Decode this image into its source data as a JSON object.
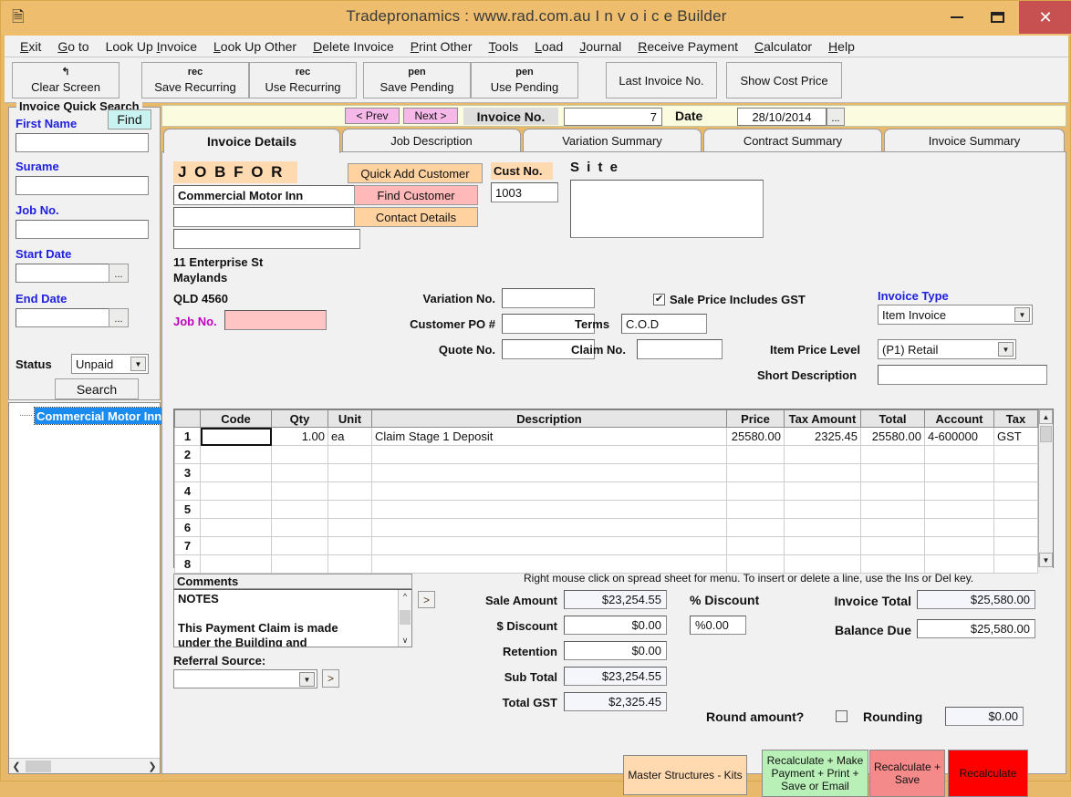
{
  "window": {
    "title": "Tradepronamics :   www.rad.com.au    I n v o i c e   Builder",
    "icon": "window-app-icon",
    "minimize": "–",
    "maximize": "□",
    "close": "✕"
  },
  "menu": [
    {
      "label": "Exit",
      "accel": "E"
    },
    {
      "label": "Go to",
      "accel": "G"
    },
    {
      "label": "Look Up Invoice",
      "accel": "I"
    },
    {
      "label": "Look Up Other",
      "accel": "L"
    },
    {
      "label": "Delete Invoice",
      "accel": "D"
    },
    {
      "label": "Print Other",
      "accel": "P"
    },
    {
      "label": "Tools",
      "accel": "T"
    },
    {
      "label": "Load",
      "accel": "L"
    },
    {
      "label": "Journal",
      "accel": "J"
    },
    {
      "label": "Receive Payment",
      "accel": "R"
    },
    {
      "label": "Calculator",
      "accel": "C"
    },
    {
      "label": "Help",
      "accel": "H"
    }
  ],
  "toolbar": [
    {
      "icon": "↰",
      "label": "Clear Screen"
    },
    {
      "icon": "rec",
      "label": "Save Recurring"
    },
    {
      "icon": "rec",
      "label": "Use Recurring"
    },
    {
      "icon": "pen",
      "label": "Save Pending"
    },
    {
      "icon": "pen",
      "label": "Use Pending"
    },
    {
      "icon": "",
      "label": "Last Invoice No."
    },
    {
      "icon": "",
      "label": "Show Cost Price"
    }
  ],
  "quick_search": {
    "legend": "Invoice Quick Search",
    "find_label": "Find",
    "first_name_label": "First Name",
    "first_name_value": "",
    "surname_label": "Surame",
    "surname_value": "",
    "job_no_label": "Job No.",
    "job_no_value": "",
    "start_date_label": "Start Date",
    "start_date_value": "",
    "end_date_label": "End Date",
    "end_date_value": "",
    "dots_label": "...",
    "status_label": "Status",
    "status_value": "Unpaid",
    "search_label": "Search",
    "tree_item": "Commercial Motor Inn"
  },
  "invoice_bar": {
    "prev_label": "< Prev",
    "next_label": "Next >",
    "invoice_no_label": "Invoice No.",
    "invoice_no_value": "7",
    "date_label": "Date",
    "date_value": "28/10/2014",
    "date_picker_label": "..."
  },
  "tabs": [
    {
      "label": "Invoice Details",
      "active": true
    },
    {
      "label": "Job Description",
      "active": false
    },
    {
      "label": "Variation Summary",
      "active": false
    },
    {
      "label": "Contract Summary",
      "active": false
    },
    {
      "label": "Invoice Summary",
      "active": false
    }
  ],
  "job_for": {
    "title": "J O B   F O R",
    "customer_name": "Commercial Motor Inn",
    "line2": "",
    "line3": "",
    "address_street": "11 Enterprise St",
    "address_suburb": "Maylands",
    "address_state_post": "QLD  4560",
    "job_no_label": "Job No.",
    "job_no_value": "",
    "quick_add_label": "Quick Add Customer",
    "find_customer_label": "Find Customer",
    "contact_details_label": "Contact Details",
    "cust_no_label": "Cust No.",
    "cust_no_value": "1003",
    "site_label": "S i t e",
    "site_value": "",
    "variation_no_label": "Variation No.",
    "variation_no_value": "",
    "customer_po_label": "Customer PO #",
    "customer_po_value": "",
    "quote_no_label": "Quote No.",
    "quote_no_value": "",
    "terms_label": "Terms",
    "terms_value": "C.O.D",
    "claim_no_label": "Claim No.",
    "claim_no_value": "",
    "gst_checkbox_label": "Sale Price Includes GST",
    "gst_checked": "✔",
    "invoice_type_label": "Invoice Type",
    "invoice_type_value": "Item Invoice",
    "item_price_level_label": "Item Price Level",
    "item_price_level_value": "(P1) Retail",
    "short_description_label": "Short Description",
    "short_description_value": ""
  },
  "grid": {
    "columns": [
      "",
      "Code",
      "Qty",
      "Unit",
      "Description",
      "Price",
      "Tax Amount",
      "Total",
      "Account",
      "Tax"
    ],
    "rows": [
      {
        "n": "1",
        "code": "",
        "qty": "1.00",
        "unit": "ea",
        "description": "Claim Stage 1 Deposit",
        "price": "25580.00",
        "tax_amount": "2325.45",
        "total": "25580.00",
        "account": "4-600000",
        "tax": "GST"
      },
      {
        "n": "2",
        "code": "",
        "qty": "",
        "unit": "",
        "description": "",
        "price": "",
        "tax_amount": "",
        "total": "",
        "account": "",
        "tax": ""
      },
      {
        "n": "3",
        "code": "",
        "qty": "",
        "unit": "",
        "description": "",
        "price": "",
        "tax_amount": "",
        "total": "",
        "account": "",
        "tax": ""
      },
      {
        "n": "4",
        "code": "",
        "qty": "",
        "unit": "",
        "description": "",
        "price": "",
        "tax_amount": "",
        "total": "",
        "account": "",
        "tax": ""
      },
      {
        "n": "5",
        "code": "",
        "qty": "",
        "unit": "",
        "description": "",
        "price": "",
        "tax_amount": "",
        "total": "",
        "account": "",
        "tax": ""
      },
      {
        "n": "6",
        "code": "",
        "qty": "",
        "unit": "",
        "description": "",
        "price": "",
        "tax_amount": "",
        "total": "",
        "account": "",
        "tax": ""
      },
      {
        "n": "7",
        "code": "",
        "qty": "",
        "unit": "",
        "description": "",
        "price": "",
        "tax_amount": "",
        "total": "",
        "account": "",
        "tax": ""
      },
      {
        "n": "8",
        "code": "",
        "qty": "",
        "unit": "",
        "description": "",
        "price": "",
        "tax_amount": "",
        "total": "",
        "account": "",
        "tax": ""
      }
    ]
  },
  "comments": {
    "header": "Comments",
    "line1": "NOTES",
    "line2": "",
    "line3": "This Payment Claim is made",
    "line4": "under the Building and",
    "expand_label": ">",
    "referral_label": "Referral Source:",
    "referral_value": "",
    "referral_expand_label": ">"
  },
  "hint": "Right mouse click on spread sheet for menu. To insert or delete a line, use the Ins or Del key.",
  "totals": {
    "sale_amount_label": "Sale Amount",
    "sale_amount_value": "$23,254.55",
    "dollar_discount_label": "$ Discount",
    "dollar_discount_value": "$0.00",
    "retention_label": "Retention",
    "retention_value": "$0.00",
    "sub_total_label": "Sub Total",
    "sub_total_value": "$23,254.55",
    "total_gst_label": "Total GST",
    "total_gst_value": "$2,325.45",
    "percent_discount_label": "% Discount",
    "percent_discount_value": "%0.00",
    "invoice_total_label": "Invoice Total",
    "invoice_total_value": "$25,580.00",
    "balance_due_label": "Balance Due",
    "balance_due_value": "$25,580.00",
    "round_amount_label": "Round amount?",
    "rounding_label": "Rounding",
    "rounding_value": "$0.00"
  },
  "actions": {
    "master_structures": "Master Structures - Kits",
    "recalc_payment": "Recalculate + Make Payment + Print + Save or Email",
    "recalc_save": "Recalculate + Save",
    "recalc": "Recalculate"
  },
  "colors": {
    "titlebar": "#eebe6e",
    "close": "#c75050",
    "accent_blue": "#2020e0",
    "tag_orange": "#ffd9af",
    "nav_pink": "#f5b8e8",
    "recalc_red": "#ff0000",
    "recalc_green": "#b8f0b8",
    "recalc_pink": "#f58a8a",
    "tree_sel": "#1a8cf0"
  }
}
